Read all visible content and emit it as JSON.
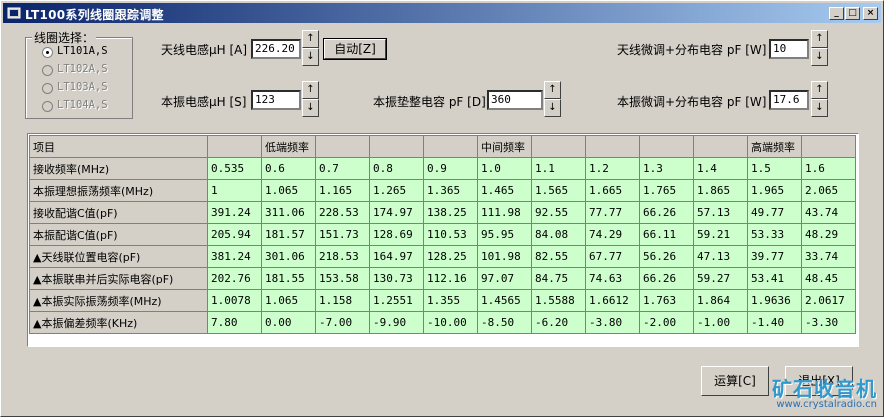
{
  "window": {
    "title": "LT100系列线圈跟踪调整",
    "controls": [
      "_",
      "□",
      "×"
    ]
  },
  "coil_group": {
    "legend": "线圈选择：",
    "options": [
      {
        "label": "LT101A,S",
        "selected": true,
        "enabled": true
      },
      {
        "label": "LT102A,S",
        "selected": false,
        "enabled": false
      },
      {
        "label": "LT103A,S",
        "selected": false,
        "enabled": false
      },
      {
        "label": "LT104A,S",
        "selected": false,
        "enabled": false
      }
    ]
  },
  "fields": {
    "antenna_inductance": {
      "label": "天线电感μH [A]",
      "value": "226.20"
    },
    "osc_inductance": {
      "label": "本振电感μH [S]",
      "value": "123"
    },
    "padder_cap": {
      "label": "本振垫整电容 pF [D]",
      "value": "360"
    },
    "antenna_trim": {
      "label": "天线微调+分布电容 pF [W]",
      "value": "10"
    },
    "osc_trim": {
      "label": "本振微调+分布电容 pF [W]",
      "value": "17.6"
    }
  },
  "buttons": {
    "auto": "自动[Z]",
    "calc": "运算[C]",
    "exit": "退出[X]"
  },
  "spin_glyphs": {
    "up": "↑",
    "down": "↓"
  },
  "table": {
    "header": [
      "项目",
      "",
      "低端频率",
      "",
      "",
      "",
      "中间频率",
      "",
      "",
      "",
      "",
      "高端频率",
      ""
    ],
    "rows": [
      {
        "label": "接收频率(MHz)",
        "values": [
          "0.535",
          "0.6",
          "0.7",
          "0.8",
          "0.9",
          "1.0",
          "1.1",
          "1.2",
          "1.3",
          "1.4",
          "1.5",
          "1.6"
        ]
      },
      {
        "label": "本振理想振荡频率(MHz)",
        "values": [
          "1",
          "1.065",
          "1.165",
          "1.265",
          "1.365",
          "1.465",
          "1.565",
          "1.665",
          "1.765",
          "1.865",
          "1.965",
          "2.065"
        ]
      },
      {
        "label": "接收配谐C值(pF)",
        "values": [
          "391.24",
          "311.06",
          "228.53",
          "174.97",
          "138.25",
          "111.98",
          "92.55",
          "77.77",
          "66.26",
          "57.13",
          "49.77",
          "43.74"
        ]
      },
      {
        "label": "本振配谐C值(pF)",
        "values": [
          "205.94",
          "181.57",
          "151.73",
          "128.69",
          "110.53",
          "95.95",
          "84.08",
          "74.29",
          "66.11",
          "59.21",
          "53.33",
          "48.29"
        ]
      },
      {
        "label": "▲天线联位置电容(pF)",
        "values": [
          "381.24",
          "301.06",
          "218.53",
          "164.97",
          "128.25",
          "101.98",
          "82.55",
          "67.77",
          "56.26",
          "47.13",
          "39.77",
          "33.74"
        ]
      },
      {
        "label": "▲本振联串并后实际电容(pF)",
        "values": [
          "202.76",
          "181.55",
          "153.58",
          "130.73",
          "112.16",
          "97.07",
          "84.75",
          "74.63",
          "66.26",
          "59.27",
          "53.41",
          "48.45"
        ]
      },
      {
        "label": "▲本振实际振荡频率(MHz)",
        "values": [
          "1.0078",
          "1.065",
          "1.158",
          "1.2551",
          "1.355",
          "1.4565",
          "1.5588",
          "1.6612",
          "1.763",
          "1.864",
          "1.9636",
          "2.0617"
        ]
      },
      {
        "label": "▲本振偏差频率(KHz)",
        "values": [
          "7.80",
          "0.00",
          "-7.00",
          "-9.90",
          "-10.00",
          "-8.50",
          "-6.20",
          "-3.80",
          "-2.00",
          "-1.00",
          "-1.40",
          "-3.30"
        ]
      }
    ]
  },
  "watermark": {
    "text": "矿石收音机",
    "url": "www.crystalradio.cn"
  },
  "colors": {
    "title_start": "#0a246a",
    "title_end": "#a6caf0",
    "cell_bg": "#ccffcc",
    "face": "#d4d0c8"
  }
}
